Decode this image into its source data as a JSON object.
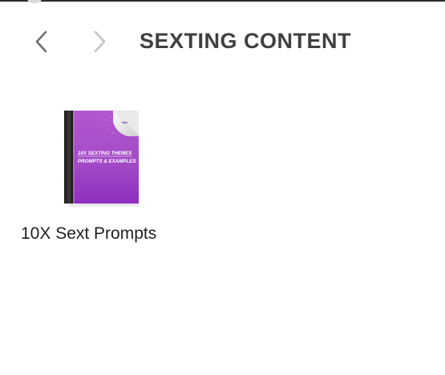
{
  "window": {
    "folder_title": "SEXTING CONTENT"
  },
  "navigation": {
    "back_icon": "chevron-left-icon",
    "forward_icon": "chevron-right-icon"
  },
  "files": [
    {
      "name": "10X Sext Prompts",
      "icon": "ebook-document-icon",
      "cover_text_line1": "10X SEXTING THEMES",
      "cover_text_line2": "PROMPTS & EXAMPLES",
      "cover_color": "#a545c9"
    }
  ]
}
